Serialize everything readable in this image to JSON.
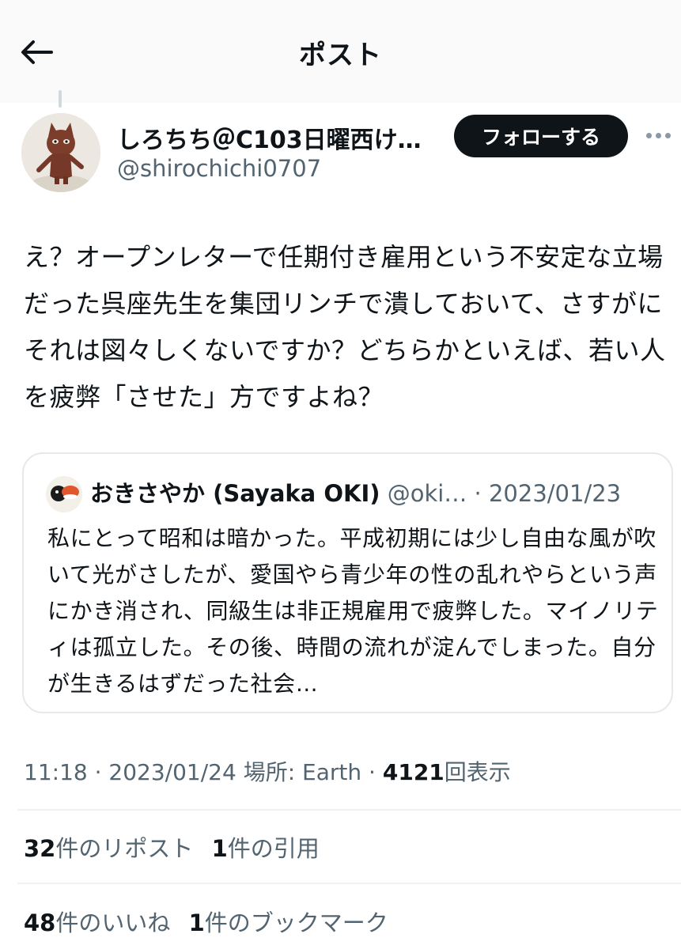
{
  "header": {
    "title": "ポスト",
    "back_icon": "arrow-left-icon"
  },
  "author": {
    "display_name": "しろちち＠C103日曜西け…",
    "handle": "@shirochichi0707",
    "follow_label": "フォローする",
    "more_icon": "more-horizontal-icon"
  },
  "post": {
    "text": "え？オープンレターで任期付き雇用という不安定な立場だった呉座先生を集団リンチで潰しておいて、さすがにそれは図々しくないですか？どちらかといえば、若い人を疲弊「させた」方ですよね？"
  },
  "quote": {
    "name": "おきさやか (Sayaka OKI)",
    "handle": "@oki…",
    "separator": "·",
    "date": "2023/01/23",
    "text": "私にとって昭和は暗かった。平成初期には少し自由な風が吹いて光がさしたが、愛国やら青少年の性の乱れやらという声にかき消され、同級生は非正規雇用で疲弊した。マイノリティは孤立した。その後、時間の流れが淀んでしまった。自分が生きるはずだった社会…"
  },
  "meta": {
    "time": "11:18",
    "sep1": "·",
    "date": "2023/01/24",
    "location": "場所: Earth",
    "sep2": "·",
    "views_count": "4121",
    "views_label": "回表示"
  },
  "stats": {
    "reposts_count": "32",
    "reposts_label": "件のリポスト",
    "quotes_count": "1",
    "quotes_label": "件の引用",
    "likes_count": "48",
    "likes_label": "件のいいね",
    "bookmarks_count": "1",
    "bookmarks_label": "件のブックマーク"
  },
  "colors": {
    "text_primary": "#0f1419",
    "text_secondary": "#536471",
    "border": "#e4e9ec",
    "follow_button_bg": "#0f1419"
  }
}
